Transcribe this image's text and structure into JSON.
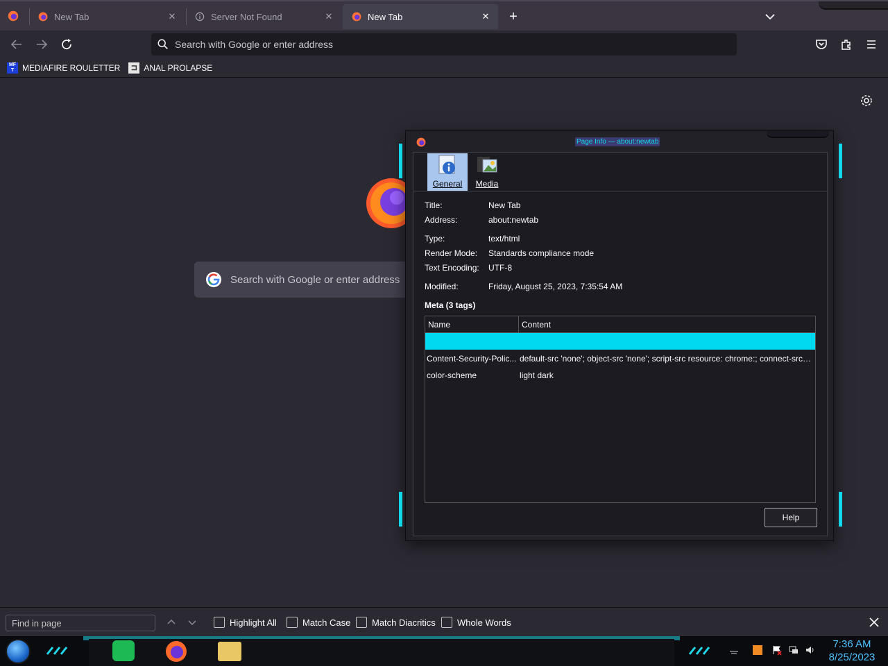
{
  "browser": {
    "tabs": [
      {
        "title": "New Tab",
        "active": false
      },
      {
        "title": "Server Not Found",
        "active": false
      },
      {
        "title": "New Tab",
        "active": true
      }
    ],
    "address_placeholder": "Search with Google or enter address",
    "bookmarks": [
      {
        "label": "MEDIAFIRE ROULETTER",
        "icon": "mediafire-icon"
      },
      {
        "label": "ANAL PROLAPSE",
        "icon": "bookmark-page-icon"
      }
    ]
  },
  "newtab": {
    "search_placeholder": "Search with Google or enter address"
  },
  "dialog": {
    "title": "Page Info — about:newtab",
    "tabs": [
      {
        "label": "General",
        "active": true
      },
      {
        "label": "Media",
        "active": false
      }
    ],
    "general": {
      "title_label": "Title:",
      "title_value": "New Tab",
      "address_label": "Address:",
      "address_value": "about:newtab",
      "type_label": "Type:",
      "type_value": "text/html",
      "render_label": "Render Mode:",
      "render_value": "Standards compliance mode",
      "encoding_label": "Text Encoding:",
      "encoding_value": "UTF-8",
      "modified_label": "Modified:",
      "modified_value": "Friday, August 25, 2023, 7:35:54 AM"
    },
    "meta_heading": "Meta (3 tags)",
    "meta_columns": [
      "Name",
      "Content"
    ],
    "meta_rows": [
      {
        "name": "Content-Security-Polic...",
        "content": "default-src 'none'; object-src 'none'; script-src resource: chrome:; connect-src ..."
      },
      {
        "name": "color-scheme",
        "content": "light dark"
      }
    ],
    "help_label": "Help"
  },
  "findbar": {
    "placeholder": "Find in page",
    "options": [
      "Highlight All",
      "Match Case",
      "Match Diacritics",
      "Whole Words"
    ]
  },
  "taskbar": {
    "time": "7:36 AM",
    "date": "8/25/2023"
  },
  "colors": {
    "accent": "#00d9ef",
    "background": "#2b2a33",
    "urlbar": "#1c1b22"
  }
}
